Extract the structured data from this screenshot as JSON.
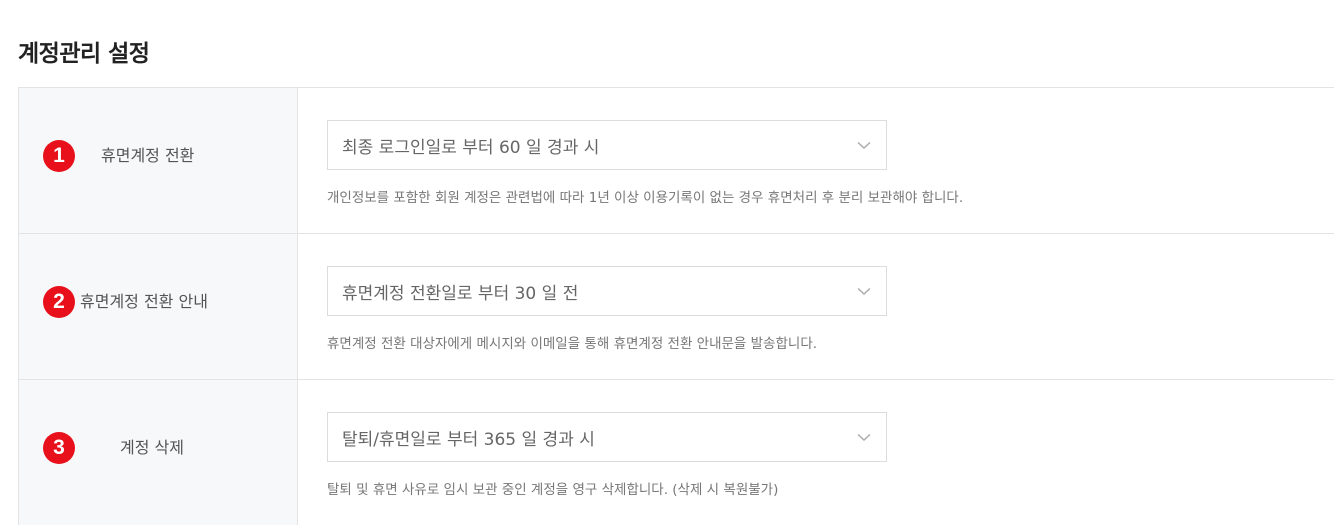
{
  "page": {
    "title": "계정관리 설정"
  },
  "settings": [
    {
      "badge": "1",
      "label": "휴면계정 전환",
      "select_value": "최종 로그인일로 부터 60 일 경과 시",
      "help": "개인정보를 포함한 회원 계정은 관련법에 따라 1년 이상 이용기록이 없는 경우 휴면처리 후 분리 보관해야 합니다."
    },
    {
      "badge": "2",
      "label": "휴면계정 전환 안내",
      "select_value": "휴면계정 전환일로 부터 30 일 전",
      "help": "휴면계정 전환 대상자에게 메시지와 이메일을 통해 휴면계정 전환 안내문을 발송합니다."
    },
    {
      "badge": "3",
      "label": "계정 삭제",
      "select_value": "탈퇴/휴면일로 부터 365 일 경과 시",
      "help": "탈퇴 및 휴면 사유로 임시 보관 중인 계정을 영구 삭제합니다. (삭제 시 복원불가)"
    }
  ],
  "colors": {
    "badge": "#e8111b",
    "label_background": "#f7f8fa",
    "border": "#e3e3e3"
  },
  "icons": {
    "select_arrow": "chevron-down-icon"
  }
}
